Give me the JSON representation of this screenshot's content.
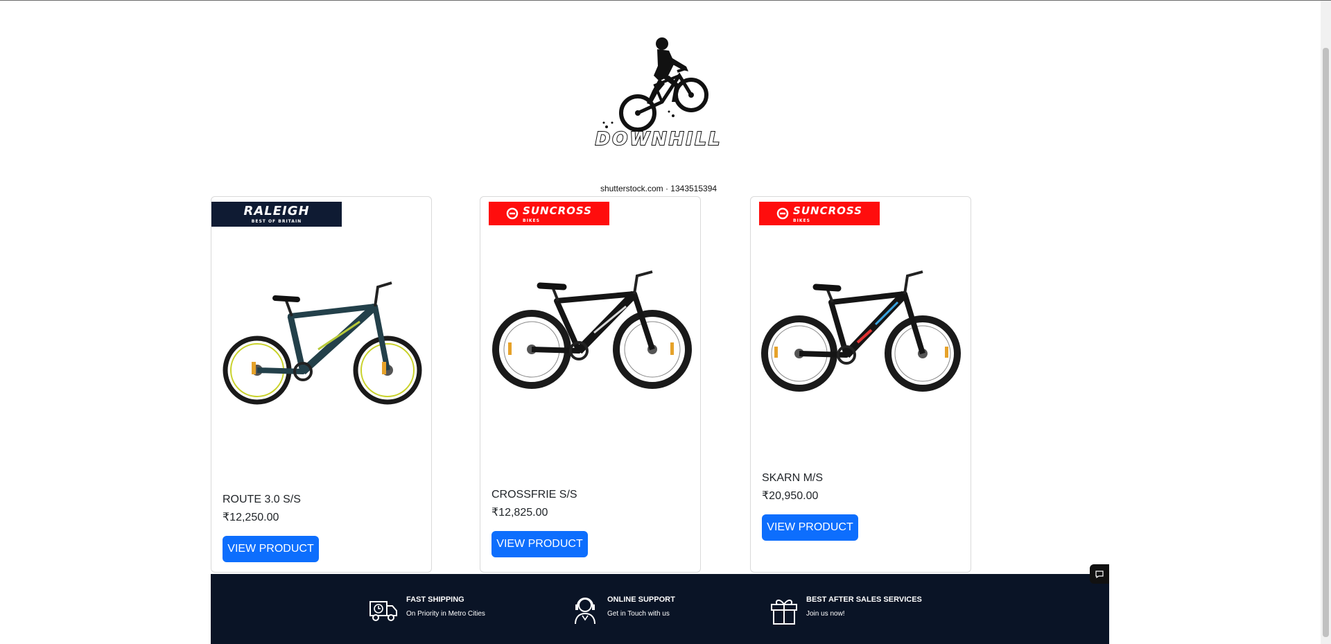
{
  "logo": {
    "wordmark": "DOWNHILL",
    "credit": "shutterstock.com · 1343515394",
    "icon": "mountain-bike-rider-icon"
  },
  "products": [
    {
      "brand": "RALEIGH",
      "brand_tagline": "BEST OF BRITAIN",
      "name": "ROUTE 3.0 S/S",
      "price": "₹12,250.00",
      "button_label": "VIEW PRODUCT"
    },
    {
      "brand": "SUNCROSS",
      "brand_tagline": "BIKES",
      "name": "CROSSFRIE S/S",
      "price": "₹12,825.00",
      "button_label": "VIEW PRODUCT"
    },
    {
      "brand": "SUNCROSS",
      "brand_tagline": "BIKES",
      "name": "SKARN M/S",
      "price": "₹20,950.00",
      "button_label": "VIEW PRODUCT"
    }
  ],
  "footer": {
    "features": [
      {
        "icon": "delivery-truck-icon",
        "title": "FAST SHIPPING",
        "subtitle": "On Priority in Metro Cities"
      },
      {
        "icon": "support-agent-icon",
        "title": "ONLINE SUPPORT",
        "subtitle": "Get in Touch with us"
      },
      {
        "icon": "gift-box-icon",
        "title": "BEST AFTER SALES SERVICES",
        "subtitle": "Join us now!"
      }
    ]
  },
  "colors": {
    "primary_button": "#0d6efd",
    "footer_bg": "#0a1426",
    "raleigh_badge": "#0f1b33",
    "suncross_badge": "#ff0d0d"
  }
}
